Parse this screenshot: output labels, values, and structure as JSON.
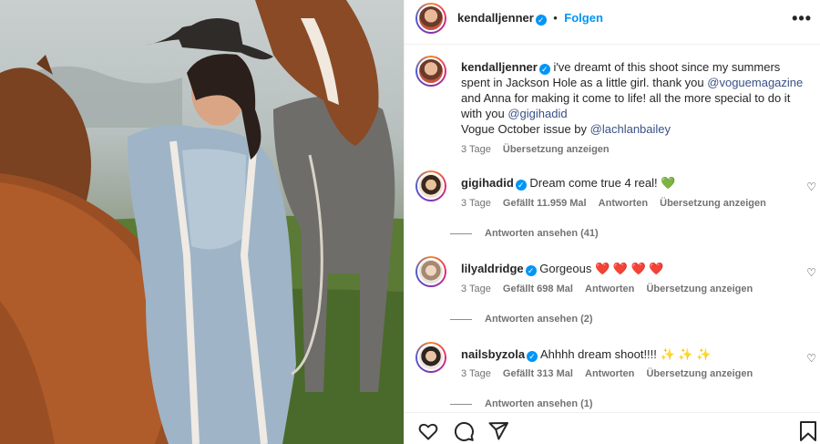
{
  "post": {
    "username": "kendalljenner",
    "follow_label": "Folgen",
    "separator": "•",
    "more_label": "•••"
  },
  "caption": {
    "username": "kendalljenner",
    "text_1": "i've dreamt of this shoot since my summers",
    "text_2": "spent in Jackson Hole as a little girl. thank you",
    "mention_1": "@voguemagazine",
    "text_3": "and Anna for making it come to life! all the more special to do it",
    "text_4": "with you",
    "mention_2": "@gigihadid",
    "text_5": "Vogue October issue by",
    "mention_3": "@lachlanbailey",
    "time": "3 Tage",
    "translate": "Übersetzung anzeigen"
  },
  "comments": [
    {
      "username": "gigihadid",
      "text": "Dream come true 4 real!",
      "emoji": "💚",
      "time": "3 Tage",
      "likes": "Gefällt 11.959 Mal",
      "reply": "Antworten",
      "translate": "Übersetzung anzeigen",
      "view_replies": "Antworten ansehen (41)"
    },
    {
      "username": "lilyaldridge",
      "text": "Gorgeous",
      "emoji": "❤️ ❤️ ❤️ ❤️",
      "time": "3 Tage",
      "likes": "Gefällt 698 Mal",
      "reply": "Antworten",
      "translate": "Übersetzung anzeigen",
      "view_replies": "Antworten ansehen (2)"
    },
    {
      "username": "nailsbyzola",
      "text": "Ahhhh dream shoot!!!!",
      "emoji": "✨ ✨ ✨",
      "time": "3 Tage",
      "likes": "Gefällt 313 Mal",
      "reply": "Antworten",
      "translate": "Übersetzung anzeigen",
      "view_replies": "Antworten ansehen (1)"
    }
  ],
  "actions": {
    "icons": [
      "heart-icon",
      "comment-icon",
      "share-icon",
      "bookmark-icon"
    ]
  },
  "colors": {
    "accent": "#0095f6",
    "mention": "#385185",
    "muted": "#737373"
  }
}
